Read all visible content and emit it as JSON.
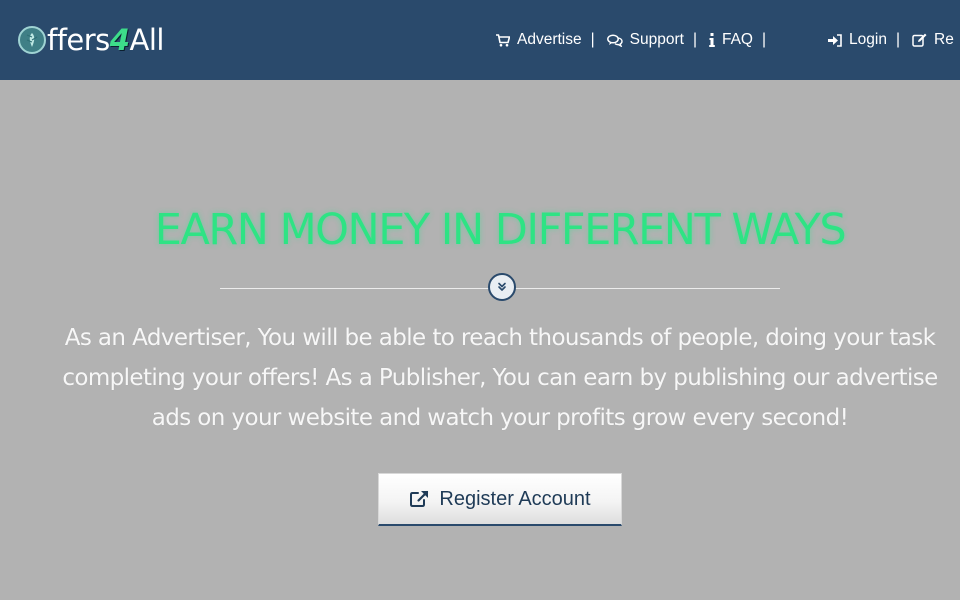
{
  "logo": {
    "text_pre": "ffers",
    "text_four": "4",
    "text_post": "All"
  },
  "nav": {
    "advertise": "Advertise",
    "support": "Support",
    "faq": "FAQ",
    "login": "Login",
    "register": "Re",
    "separator": "|"
  },
  "hero": {
    "title": "EARN MONEY IN DIFFERENT WAYS",
    "line1": "As an Advertiser, You will be able to reach thousands of people, doing your task",
    "line2": "completing your offers! As a Publisher, You can earn by publishing our advertise",
    "line3": "ads on your website and watch your profits grow every second!",
    "cta_label": "Register Account"
  },
  "colors": {
    "header_bg": "#2a4a6c",
    "body_bg": "#b2b2b2",
    "accent_green": "#2ee384"
  },
  "icons": {
    "logo": "leaf-globe-icon",
    "advertise": "shopping-cart-icon",
    "support": "chat-bubbles-icon",
    "faq": "info-icon",
    "login": "sign-in-icon",
    "register": "edit-icon",
    "divider": "double-chevron-down-icon",
    "cta": "external-link-icon"
  }
}
